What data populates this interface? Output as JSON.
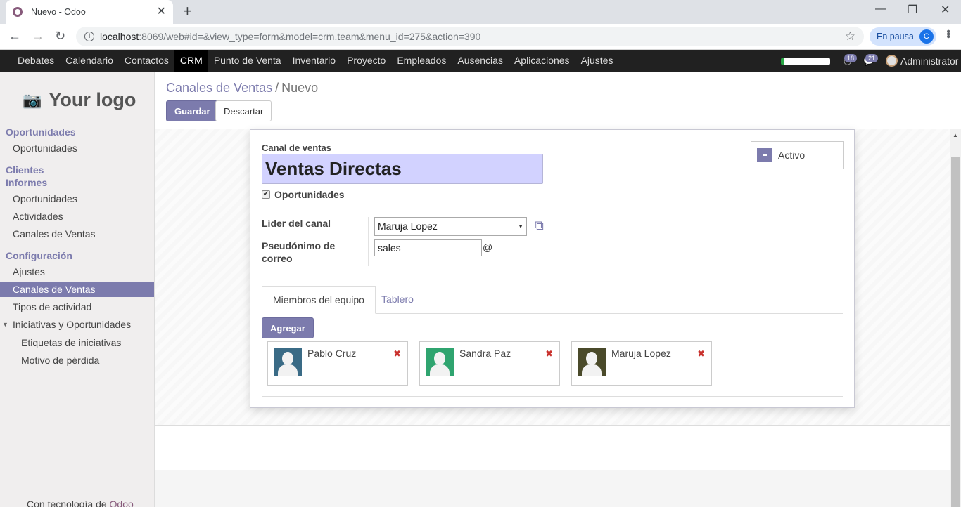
{
  "browser": {
    "tab_title": "Nuevo - Odoo",
    "url_host": "localhost",
    "url_rest": ":8069/web#id=&view_type=form&model=crm.team&menu_id=275&action=390",
    "profile_status": "En pausa",
    "profile_initial": "C"
  },
  "navbar": {
    "menu": [
      "Debates",
      "Calendario",
      "Contactos",
      "CRM",
      "Punto de Venta",
      "Inventario",
      "Proyecto",
      "Empleados",
      "Ausencias",
      "Aplicaciones",
      "Ajustes"
    ],
    "active": "CRM",
    "activity_count": "18",
    "messages_count": "21",
    "user": "Administrator"
  },
  "sidebar": {
    "logo_text": "Your logo",
    "sections": {
      "oportunidades": "Oportunidades",
      "oportunidades_item": "Oportunidades",
      "clientes": "Clientes",
      "informes": "Informes",
      "informes_items": [
        "Oportunidades",
        "Actividades",
        "Canales de Ventas"
      ],
      "configuracion": "Configuración",
      "config_items": [
        "Ajustes",
        "Canales de Ventas",
        "Tipos de actividad",
        "Iniciativas y Oportunidades"
      ],
      "config_sub_items": [
        "Etiquetas de iniciativas",
        "Motivo de pérdida"
      ]
    },
    "powered_prefix": "Con tecnología de ",
    "powered_brand": "Odoo"
  },
  "control_panel": {
    "breadcrumb_parent": "Canales de Ventas",
    "breadcrumb_sep": "/",
    "breadcrumb_current": "Nuevo",
    "save_label": "Guardar",
    "discard_label": "Descartar"
  },
  "form": {
    "name_label": "Canal de ventas",
    "name_value": "Ventas Directas",
    "opportunities_checkbox": "Oportunidades",
    "active_button": "Activo",
    "leader_label": "Líder del canal",
    "leader_value": "Maruja Lopez",
    "alias_label_1": "Pseudónimo de",
    "alias_label_2": "correo",
    "alias_value": "sales",
    "alias_at": "@",
    "tabs": [
      "Miembros del equipo",
      "Tablero"
    ],
    "add_label": "Agregar",
    "members": [
      {
        "name": "Pablo Cruz",
        "color": "#3a6b86"
      },
      {
        "name": "Sandra Paz",
        "color": "#2fa46f"
      },
      {
        "name": "Maruja Lopez",
        "color": "#4a4a2a"
      }
    ]
  }
}
